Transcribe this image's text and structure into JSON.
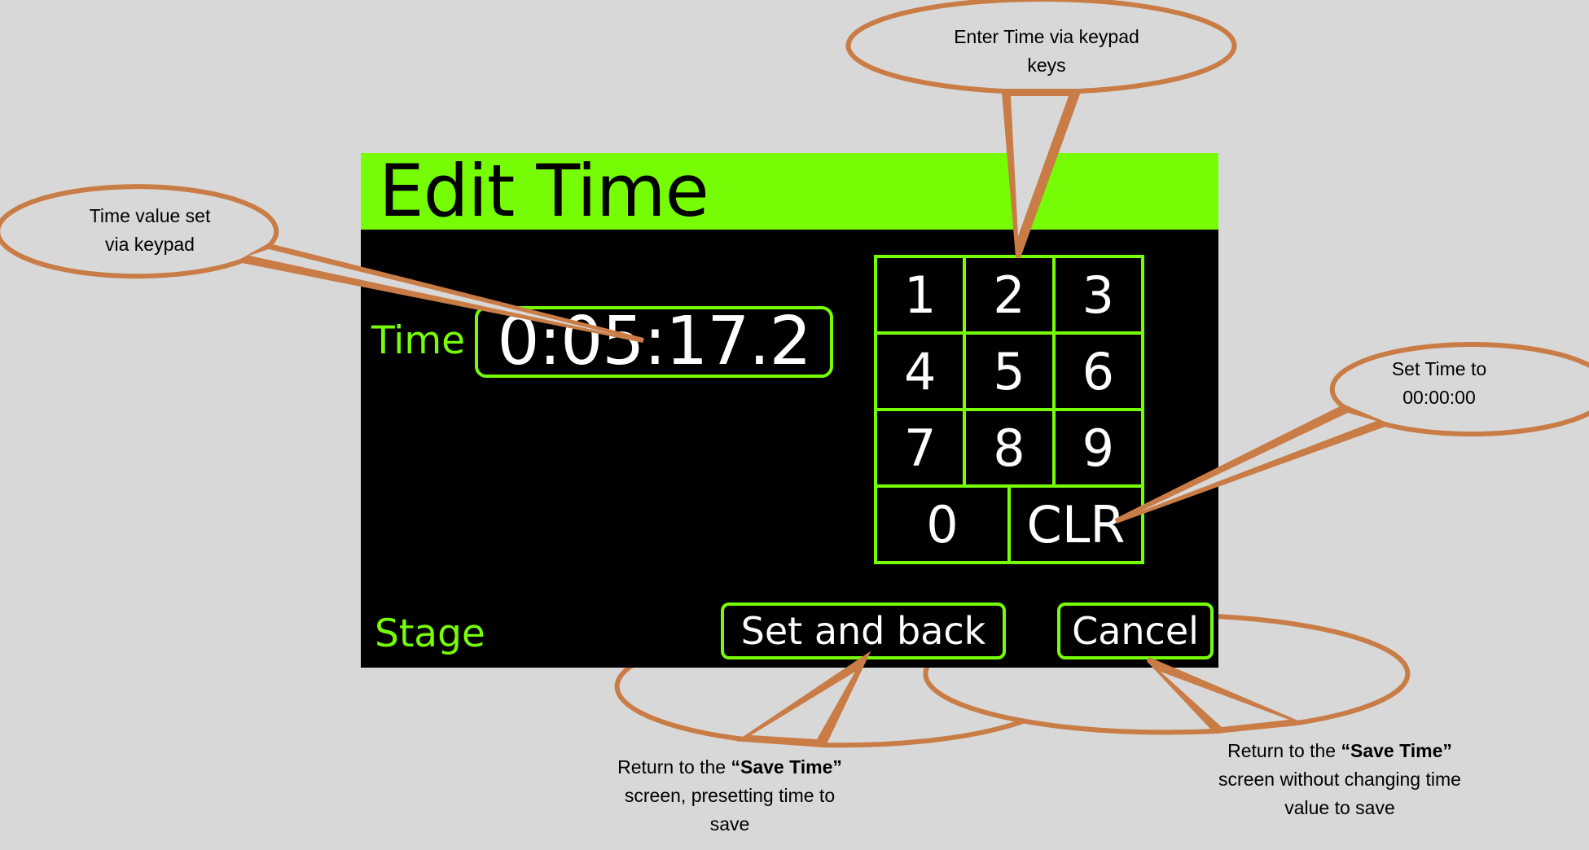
{
  "screen": {
    "title": "Edit Time",
    "time_label": "Time",
    "time_value": "0:05:17.2",
    "stage_label": "Stage",
    "keypad": {
      "keys": [
        "1",
        "2",
        "3",
        "4",
        "5",
        "6",
        "7",
        "8",
        "9"
      ],
      "zero": "0",
      "clear": "CLR"
    },
    "buttons": {
      "set_and_back": "Set and back",
      "cancel": "Cancel"
    }
  },
  "callouts": {
    "keypad": [
      "Enter Time via keypad",
      "keys"
    ],
    "time_value": [
      "Time value set",
      "via keypad"
    ],
    "clear": [
      "Set Time to",
      "00:00:00"
    ],
    "set_and_back": {
      "prefix": "Return to the ",
      "bold": "“Save Time”",
      "line2": "screen, presetting time to",
      "line3": "save"
    },
    "cancel": {
      "prefix": "Return to the ",
      "bold": "“Save Time”",
      "line2": "screen without changing time",
      "line3": "value to save"
    }
  },
  "colors": {
    "background": "#d8d8d8",
    "screen": "#000000",
    "accent_green": "#76fd06",
    "callout_stroke": "#c97c45",
    "callout_fill": "#d8d8d8"
  }
}
